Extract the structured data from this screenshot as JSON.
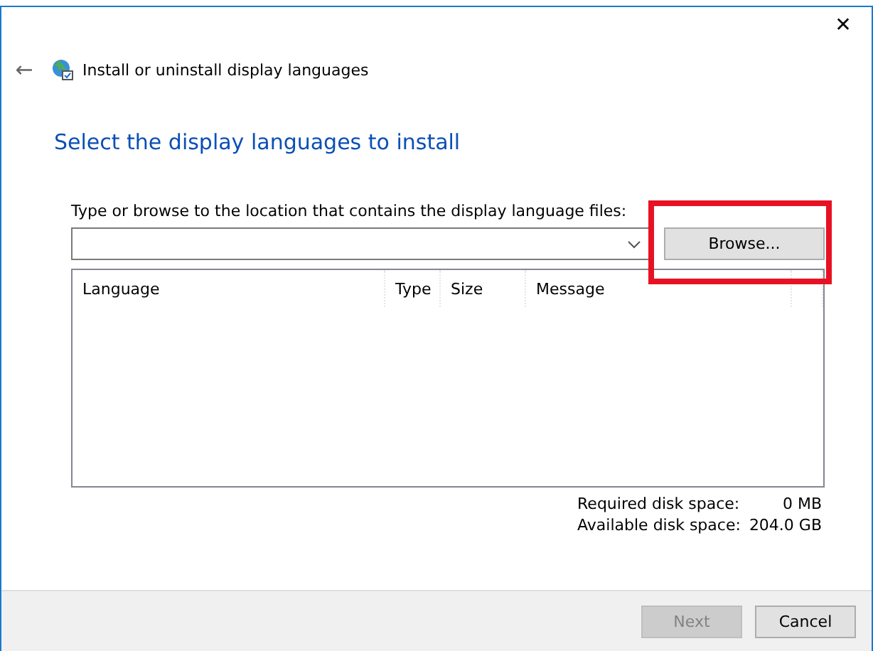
{
  "window": {
    "close": "✕"
  },
  "header": {
    "back": "←",
    "title": "Install or uninstall display languages"
  },
  "heading": "Select the display languages to install",
  "location": {
    "label": "Type or browse to the location that contains the display language files:",
    "browse": "Browse...",
    "highlighted": true
  },
  "table": {
    "columns": [
      "Language",
      "Type",
      "Size",
      "Message"
    ]
  },
  "disk": [
    {
      "label": "Required disk space:",
      "value": "0 MB"
    },
    {
      "label": "Available disk space:",
      "value": "204.0 GB"
    }
  ],
  "buttons": [
    {
      "label": "Next",
      "disabled": true
    },
    {
      "label": "Cancel",
      "disabled": false
    }
  ]
}
